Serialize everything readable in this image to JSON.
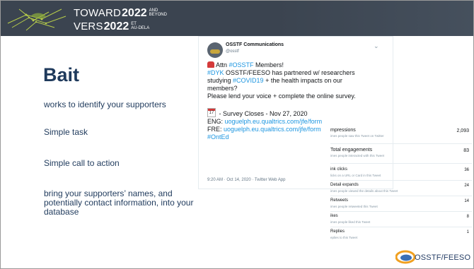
{
  "header": {
    "line1_word": "TOWARD",
    "line1_year": "2022",
    "line1_small": [
      "AND",
      "BEYOND"
    ],
    "line2_word": "VERS",
    "line2_year": "2022",
    "line2_small": [
      "ET",
      "AU-DELA"
    ]
  },
  "slide": {
    "title": "Bait",
    "points": [
      "works to identify your supporters",
      "Simple task",
      "Simple call to action",
      "bring your supporters’ names, and potentially contact information, into your database"
    ]
  },
  "tweet": {
    "account_name": "OSSTF Communications",
    "handle": "@osstf",
    "line1_pre": "Attn ",
    "line1_hash": "#OSSTF",
    "line1_post": " Members!",
    "line2_hash": "#DYK",
    "line2_post": " OSSTF/FEESO has partnered w/ researchers",
    "line3_pre": "studying ",
    "line3_hash": "#COVID19",
    "line3_post": " + the health impacts on our",
    "line4": "members?",
    "line5": "Please lend your voice + complete the online survey.",
    "calendar_num": "17",
    "line6": " - Survey Closes - Nov 27, 2020",
    "line7_pre": "ENG: ",
    "line7_link": "uoguelph.eu.qualtrics.com/jfe/form",
    "line8_pre": "FRE: ",
    "line8_link": "uoguelph.eu.qualtrics.com/jfe/form",
    "line9_hash": "#OntEd",
    "meta": "9:20 AM · Oct 14, 2020 · Twitter Web App"
  },
  "analytics": {
    "rows": [
      {
        "label": "mpressions",
        "desc": "imes people saw this Tweet on Twitter",
        "value": "2,093"
      },
      {
        "label": "Total engagements",
        "desc": "imes people interacted with this Tweet",
        "value": "83"
      },
      {
        "label": "ink clicks",
        "desc": "licks on a URL or Card in this Tweet",
        "value": "36"
      },
      {
        "label": "Detail expands",
        "desc": "imes people viewed the details about this Tweet",
        "value": "24"
      },
      {
        "label": "Retweets",
        "desc": "imes people retweeted this Tweet",
        "value": "14"
      },
      {
        "label": "ikes",
        "desc": "imes people liked this Tweet",
        "value": "8"
      },
      {
        "label": "Replies",
        "desc": "eplies to this Tweet",
        "value": "1"
      }
    ]
  },
  "logo": {
    "text": "OSSTF/FEESO"
  }
}
